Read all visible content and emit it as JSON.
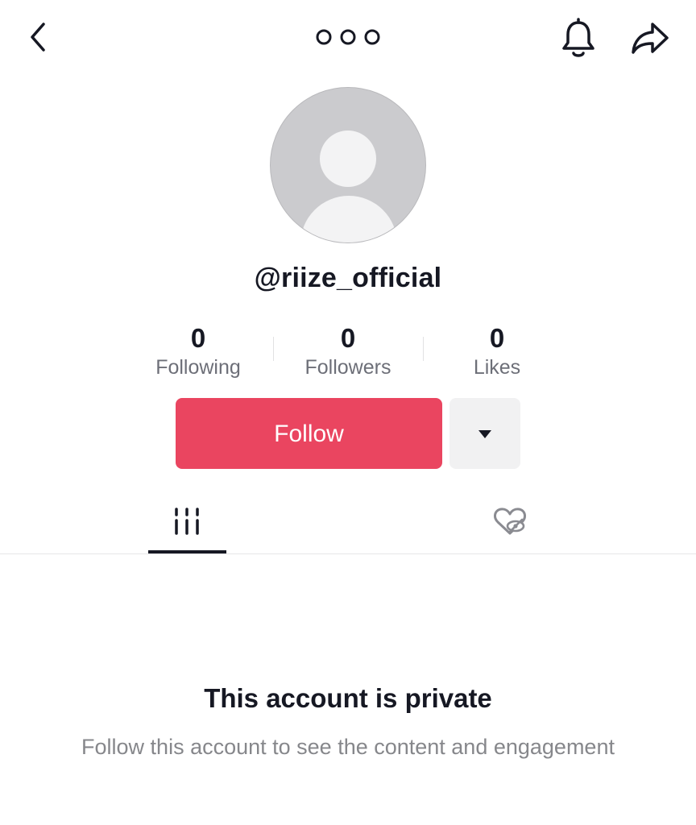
{
  "header": {
    "back_icon": "chevron-left-icon",
    "more_icon": "three-dots-icon",
    "bell_icon": "bell-icon",
    "share_icon": "share-arrow-icon"
  },
  "profile": {
    "avatar_icon": "default-avatar-icon",
    "username": "@riize_official"
  },
  "stats": [
    {
      "value": "0",
      "label": "Following"
    },
    {
      "value": "0",
      "label": "Followers"
    },
    {
      "value": "0",
      "label": "Likes"
    }
  ],
  "actions": {
    "follow_label": "Follow",
    "more_icon": "caret-down-icon",
    "accent_color": "#ea4560"
  },
  "tabs": [
    {
      "icon": "grid-icon",
      "selected": true
    },
    {
      "icon": "liked-hidden-icon",
      "selected": false
    }
  ],
  "private_notice": {
    "title": "This account is private",
    "subtitle": "Follow this account to see the content and engagement"
  }
}
